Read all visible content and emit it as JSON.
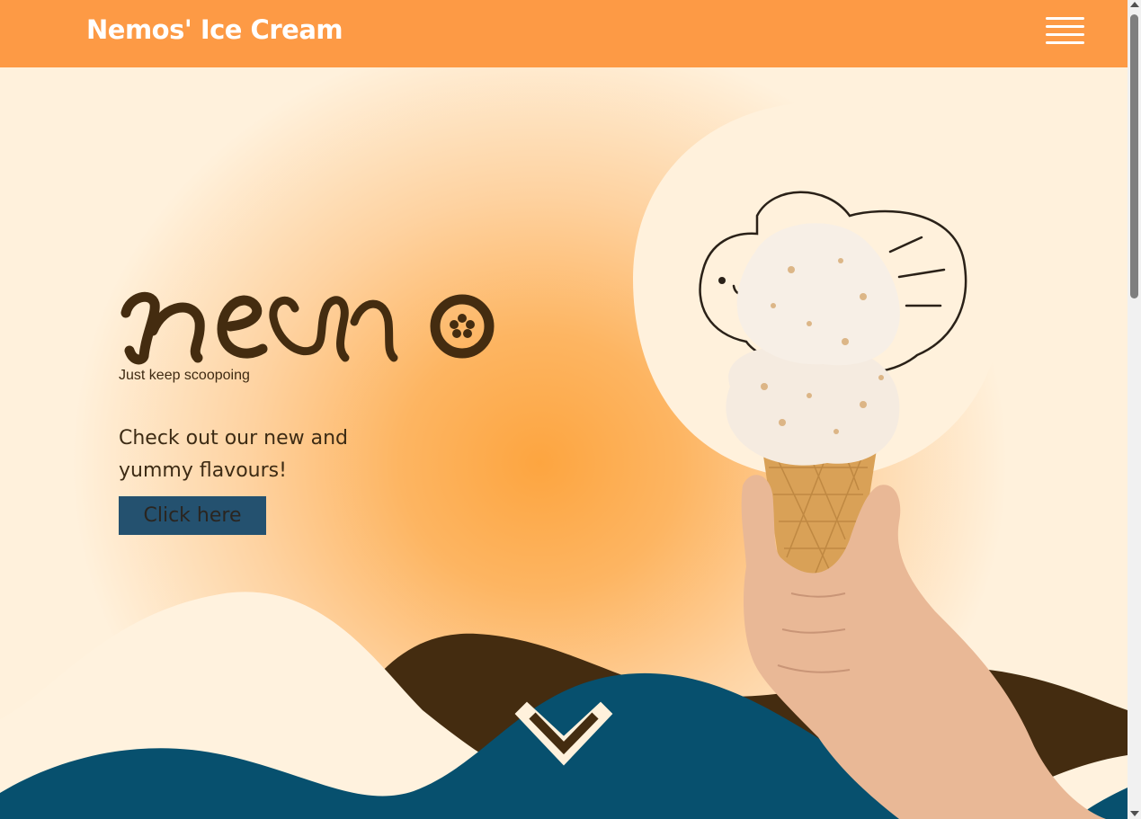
{
  "navbar": {
    "brand": "Nemos' Ice Cream",
    "menu_icon": "hamburger-menu-icon"
  },
  "hero": {
    "logo_text": "nemo",
    "tagline": "Just keep scoopoing",
    "promo_text": "Check out our new and yummy flavours!",
    "cta_label": "Click here",
    "scroll_icon": "chevron-down-icon"
  },
  "colors": {
    "navbar": "#fd9a45",
    "cream": "#fff1dc",
    "chocolate": "#442c10",
    "ocean_blue": "#07506e",
    "button": "#24516f"
  }
}
